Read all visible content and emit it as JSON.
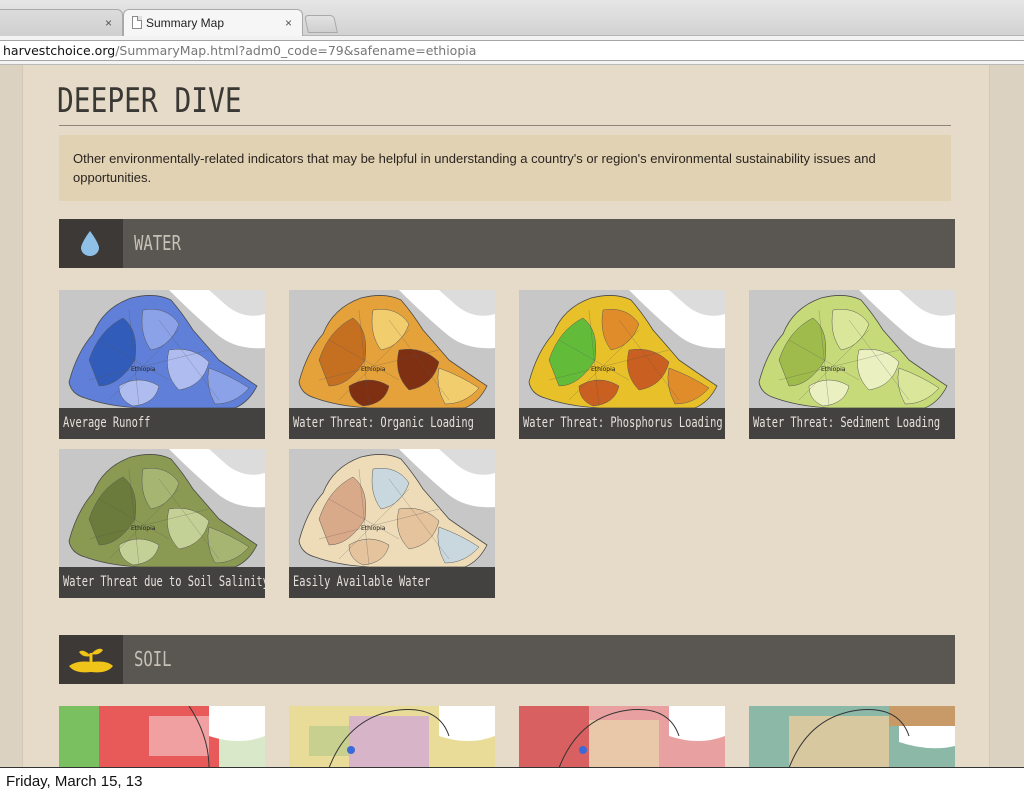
{
  "browser": {
    "tabs": [
      {
        "label": "",
        "close": "×"
      },
      {
        "label": "Summary Map",
        "close": "×"
      }
    ],
    "url_host": "harvestchoice.org",
    "url_path": "/SummaryMap.html?adm0_code=79&safename=ethiopia"
  },
  "page": {
    "heading": "DEEPER DIVE",
    "intro": "Other environmentally-related indicators that may be helpful in understanding a country's or region's environmental sustainability issues and opportunities.",
    "sections": [
      {
        "label": "WATER",
        "icon": "water-drop-icon",
        "icon_color": "#8fc0e8"
      },
      {
        "label": "SOIL",
        "icon": "sprout-icon",
        "icon_color": "#f0c418"
      }
    ],
    "water_tiles": [
      {
        "caption": "Average Runoff",
        "map_label": "Ethiopia",
        "colors": [
          "#5f7fd8",
          "#2f5bb8",
          "#8ea4ea",
          "#b4c0f2"
        ]
      },
      {
        "caption": "Water Threat: Organic Loading",
        "map_label": "Ethiopia",
        "colors": [
          "#e6a23a",
          "#c46e20",
          "#f2d070",
          "#7a2a10"
        ]
      },
      {
        "caption": "Water Threat: Phosphorus Loading",
        "map_label": "Ethiopia",
        "colors": [
          "#e8c02a",
          "#5cbc3a",
          "#e08a2a",
          "#c85a20"
        ]
      },
      {
        "caption": "Water Threat: Sediment Loading",
        "map_label": "Ethiopia",
        "colors": [
          "#c6da7a",
          "#9cba4a",
          "#dce89c",
          "#eef2c4"
        ]
      },
      {
        "caption": "Water Threat due to Soil Salinity",
        "map_label": "Ethiopia",
        "colors": [
          "#8a9a52",
          "#6a7a3a",
          "#a8b874",
          "#c8d49a"
        ]
      },
      {
        "caption": "Easily Available Water",
        "map_label": "Ethiopia",
        "colors": [
          "#eedcb8",
          "#d8a888",
          "#c8d8e2",
          "#e4c29c"
        ]
      }
    ]
  },
  "footer": {
    "date": "Friday, March 15, 13"
  }
}
